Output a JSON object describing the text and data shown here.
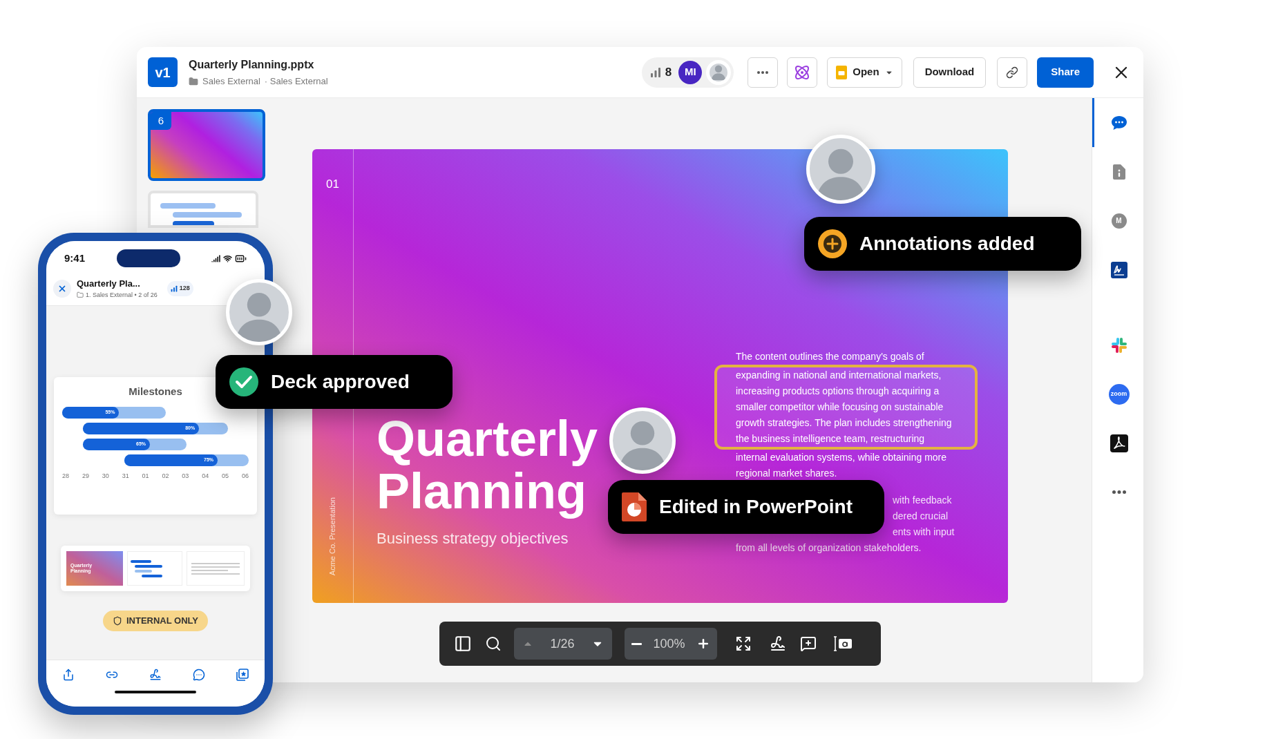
{
  "window": {
    "version_badge": "v1",
    "title": "Quarterly Planning.pptx",
    "breadcrumbs": [
      "Sales External",
      "· Sales External"
    ],
    "viewer_count": "8",
    "collaborator_initials": "MI",
    "open_button": "Open",
    "download_button": "Download",
    "share_button": "Share"
  },
  "thumbnails": [
    {
      "kind": "gradient",
      "number": "6",
      "selected": true
    },
    {
      "kind": "chart",
      "selected": false
    }
  ],
  "slide": {
    "number": "01",
    "title": "Quarterly Planning",
    "subtitle": "Business strategy objectives",
    "vertical_caption": "Acme Co. Presentation",
    "paragraph_parts": [
      {
        "kind": "plain",
        "text": "The content outlines the company's goals of"
      },
      {
        "kind": "highlighted",
        "text": "expanding in national and international markets, increasing products options through acquiring a smaller competitor while focusing on sustainable growth strategies. The plan includes strengthening the business intelligence team, restructuring"
      },
      {
        "kind": "plain",
        "text": "internal evaluation systems, while obtaining more regional market shares."
      }
    ],
    "paragraph_2_visible": [
      "with feedback",
      "dered crucial",
      "ents with input"
    ],
    "paragraph_2_last_line": "from all levels of organization stakeholders."
  },
  "toolbar": {
    "page": "1/26",
    "previous_disabled": true,
    "zoom": "100%"
  },
  "sidebar": {
    "items": [
      {
        "kind": "comments",
        "selected": true
      },
      {
        "kind": "info",
        "selected": false
      },
      {
        "kind": "letter",
        "label": "M",
        "selected": false
      },
      {
        "kind": "signature",
        "selected": false
      },
      {
        "kind": "slack",
        "selected": false
      },
      {
        "kind": "zoom",
        "label": "zoom",
        "selected": false
      },
      {
        "kind": "acrobat",
        "selected": false
      },
      {
        "kind": "more",
        "selected": false
      }
    ]
  },
  "notifications": [
    {
      "kind": "annotation",
      "text": "Annotations added"
    },
    {
      "kind": "approved",
      "text": "Deck approved"
    },
    {
      "kind": "powerpoint",
      "text": "Edited in PowerPoint"
    }
  ],
  "phone": {
    "time": "9:41",
    "title": "Quarterly Pla...",
    "folder_line": "1. Sales External • 2 of 26",
    "viewer_count": "128",
    "card_title": "Milestones",
    "milestones": [
      {
        "label": "55%",
        "level": 0.55
      },
      {
        "label": "80%",
        "level": 0.8
      },
      {
        "label": "65%",
        "level": 0.65
      },
      {
        "label": "75%",
        "level": 0.75
      }
    ],
    "axis": [
      "28",
      "29",
      "30",
      "31",
      "01",
      "02",
      "03",
      "04",
      "05",
      "06"
    ],
    "thumbnail_title": "Quarterly Planning",
    "badge": "INTERNAL ONLY"
  }
}
